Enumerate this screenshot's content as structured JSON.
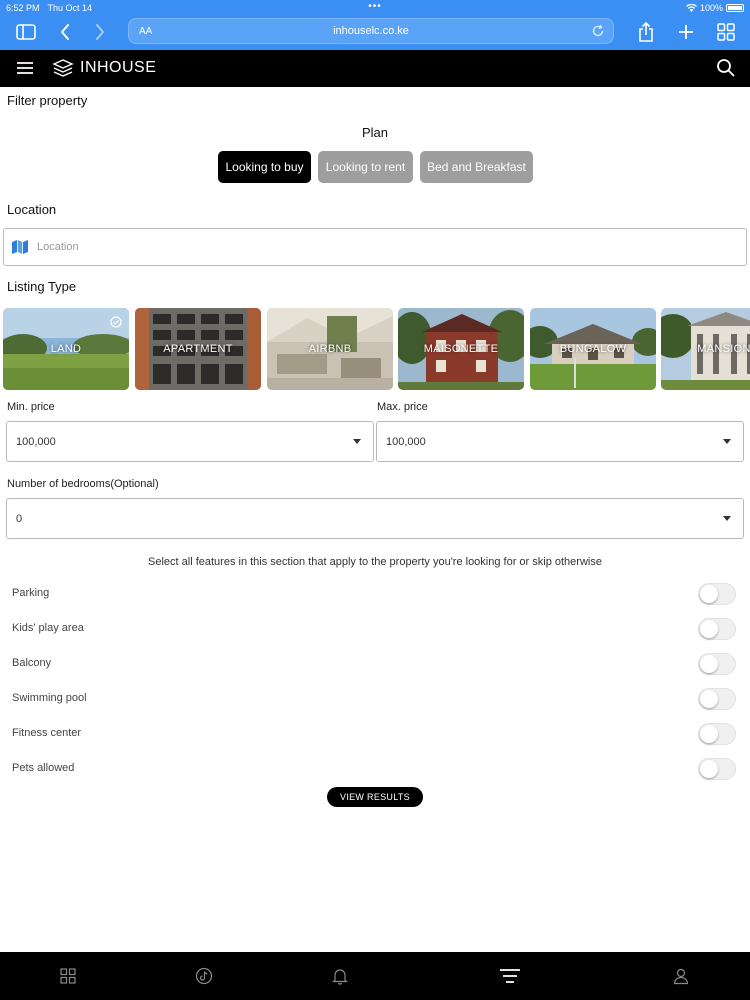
{
  "status_bar": {
    "time": "6:52 PM",
    "date": "Thu Oct 14",
    "battery": "100%"
  },
  "browser": {
    "url": "inhouselc.co.ke",
    "text_size_label": "AA"
  },
  "app": {
    "brand": "INHOUSE"
  },
  "filter": {
    "title": "Filter property",
    "plan_label": "Plan",
    "plan_options": [
      {
        "label": "Looking to buy",
        "selected": true
      },
      {
        "label": "Looking to rent",
        "selected": false
      },
      {
        "label": "Bed and Breakfast",
        "selected": false
      }
    ]
  },
  "location": {
    "title": "Location",
    "placeholder": "Location",
    "value": ""
  },
  "listing": {
    "title": "Listing Type",
    "types": [
      {
        "label": "LAND",
        "selected": true
      },
      {
        "label": "APARTMENT",
        "selected": false
      },
      {
        "label": "AIRBNB",
        "selected": false
      },
      {
        "label": "MAISONETTE",
        "selected": false
      },
      {
        "label": "BUNGALOW",
        "selected": false
      },
      {
        "label": "MANSION",
        "selected": false
      }
    ]
  },
  "price": {
    "min_label": "Min. price",
    "min_value": "100,000",
    "max_label": "Max. price",
    "max_value": "100,000"
  },
  "bedrooms": {
    "label": "Number of bedrooms(Optional)",
    "value": "0"
  },
  "features": {
    "note": "Select all features in this section that apply to the property you're looking for or skip otherwise",
    "items": [
      {
        "label": "Parking",
        "on": false
      },
      {
        "label": "Kids' play area",
        "on": false
      },
      {
        "label": "Balcony",
        "on": false
      },
      {
        "label": "Swimming pool",
        "on": false
      },
      {
        "label": "Fitness center",
        "on": false
      },
      {
        "label": "Pets allowed",
        "on": false
      }
    ]
  },
  "actions": {
    "view_results": "VIEW RESULTS"
  },
  "colors": {
    "browser_bar": "#3b8ff2",
    "selected_plan": "#000000",
    "unselected_plan": "#9e9e9e",
    "location_icon": "#2f7fd6"
  },
  "bottom_nav": [
    "grid-icon",
    "tiktok-icon",
    "bell-icon",
    "menu-lines-icon",
    "user-icon"
  ]
}
